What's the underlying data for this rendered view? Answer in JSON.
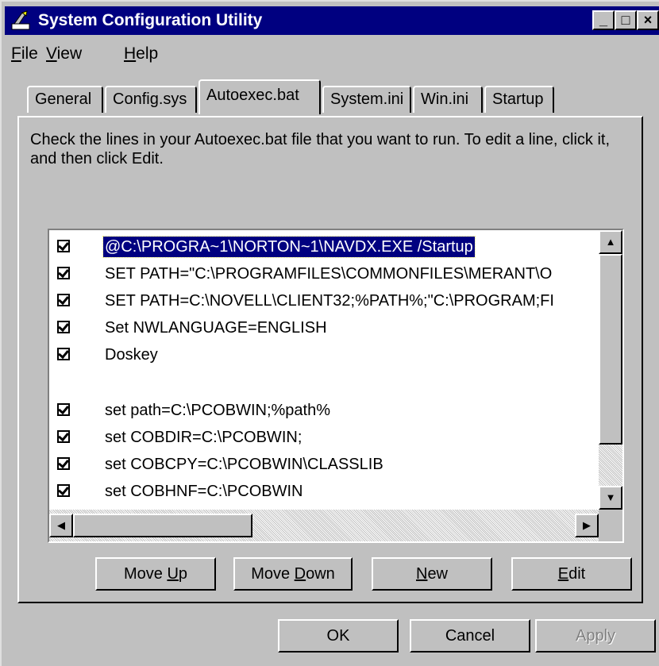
{
  "window": {
    "title": "System Configuration Utility",
    "icon": "msconfig-app-icon"
  },
  "title_buttons": {
    "minimize": "_",
    "maximize": "□",
    "close": "×"
  },
  "menu": [
    {
      "label": "File",
      "hotkey": "F",
      "rest": "ile"
    },
    {
      "label": "View",
      "hotkey": "V",
      "rest": "iew"
    },
    {
      "label": "Help",
      "hotkey": "H",
      "rest": "elp"
    }
  ],
  "tabs": [
    "General",
    "Config.sys",
    "Autoexec.bat",
    "System.ini",
    "Win.ini",
    "Startup"
  ],
  "active_tab": "Autoexec.bat",
  "instructions": "Check the lines in your Autoexec.bat file that you want to run. To edit a line, click it, and then click Edit.",
  "lines": [
    {
      "checked": true,
      "text": "@C:\\PROGRA~1\\NORTON~1\\NAVDX.EXE /Startup",
      "selected": true
    },
    {
      "checked": true,
      "text": "SET PATH=\"C:\\PROGRAMFILES\\COMMONFILES\\MERANT\\O"
    },
    {
      "checked": true,
      "text": "SET PATH=C:\\NOVELL\\CLIENT32;%PATH%;\"C:\\PROGRAM;FI"
    },
    {
      "checked": true,
      "text": "Set NWLANGUAGE=ENGLISH"
    },
    {
      "checked": true,
      "text": "Doskey"
    },
    {
      "checked": null,
      "text": ""
    },
    {
      "checked": true,
      "text": "set path=C:\\PCOBWIN;%path%"
    },
    {
      "checked": true,
      "text": "set COBDIR=C:\\PCOBWIN;"
    },
    {
      "checked": true,
      "text": "set COBCPY=C:\\PCOBWIN\\CLASSLIB"
    },
    {
      "checked": true,
      "text": "set COBHNF=C:\\PCOBWIN"
    }
  ],
  "actions": {
    "move_up": {
      "pre": "Move ",
      "hot": "U",
      "post": "p"
    },
    "move_down": {
      "pre": "Move ",
      "hot": "D",
      "post": "own"
    },
    "new": {
      "pre": "",
      "hot": "N",
      "post": "ew"
    },
    "edit": {
      "pre": "",
      "hot": "E",
      "post": "dit"
    }
  },
  "dialog_buttons": {
    "ok": "OK",
    "cancel": "Cancel",
    "apply": "Apply"
  },
  "colors": {
    "face": "#c0c0c0",
    "titlebar": "#000080",
    "selection": "#000080",
    "disabled_text": "#808080"
  }
}
